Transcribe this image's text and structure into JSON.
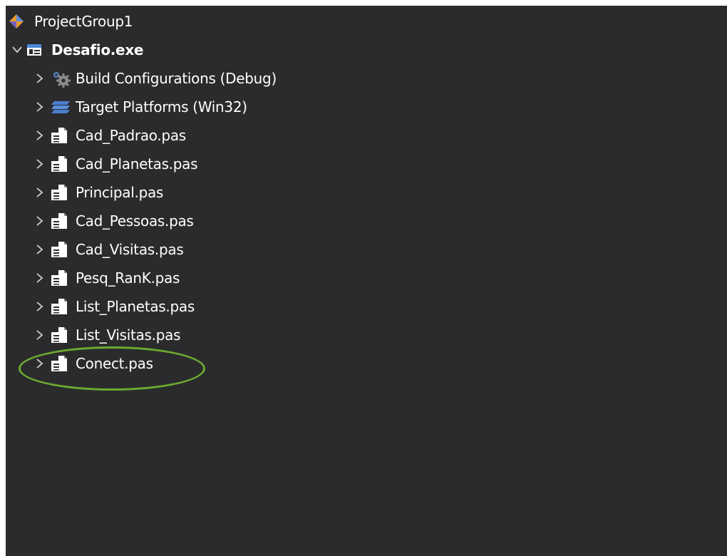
{
  "tree": {
    "group": {
      "label": "ProjectGroup1",
      "icon": "project-group-icon"
    },
    "project": {
      "label": "Desafio.exe",
      "icon": "project-exe-icon",
      "expanded": true
    },
    "items": [
      {
        "label": "Build Configurations (Debug)",
        "icon": "build-config-gear-icon"
      },
      {
        "label": "Target Platforms (Win32)",
        "icon": "target-platforms-icon"
      },
      {
        "label": "Cad_Padrao.pas",
        "icon": "pas-file-icon"
      },
      {
        "label": "Cad_Planetas.pas",
        "icon": "pas-file-icon"
      },
      {
        "label": "Principal.pas",
        "icon": "pas-file-icon"
      },
      {
        "label": "Cad_Pessoas.pas",
        "icon": "pas-file-icon"
      },
      {
        "label": "Cad_Visitas.pas",
        "icon": "pas-file-icon"
      },
      {
        "label": "Pesq_RanK.pas",
        "icon": "pas-file-icon"
      },
      {
        "label": "List_Planetas.pas",
        "icon": "pas-file-icon"
      },
      {
        "label": "List_Visitas.pas",
        "icon": "pas-file-icon"
      },
      {
        "label": "Conect.pas",
        "icon": "pas-file-icon",
        "highlighted": true
      }
    ]
  },
  "colors": {
    "background": "#2b2b2e",
    "text": "#ffffff",
    "highlight_ring": "#6cab2f"
  }
}
